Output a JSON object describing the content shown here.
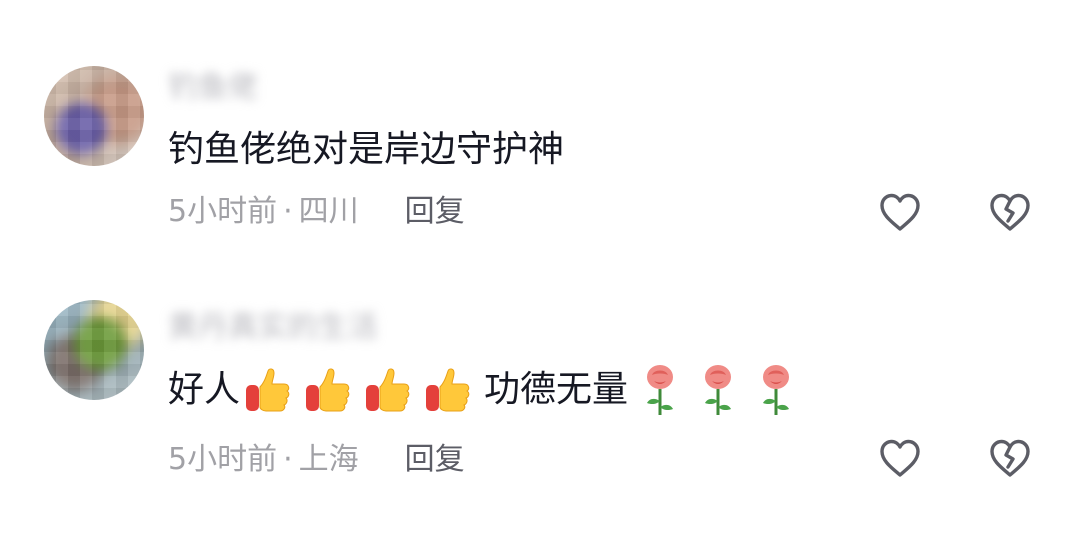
{
  "comments": [
    {
      "username": "钓鱼佬",
      "text": "钓鱼佬绝对是岸边守护神",
      "time": "5小时前",
      "separator": "·",
      "location": "四川",
      "reply_label": "回复",
      "like_icon": "heart-outline-icon",
      "dislike_icon": "broken-heart-icon"
    },
    {
      "username": "黄丹真实的生活",
      "text_parts": [
        "好人",
        "功德无量"
      ],
      "thumbs_emoji": "thumbs-up-emoji",
      "rose_emoji": "rose-emoji",
      "time": "5小时前",
      "separator": "·",
      "location": "上海",
      "reply_label": "回复",
      "like_icon": "heart-outline-icon",
      "dislike_icon": "broken-heart-icon"
    }
  ],
  "colors": {
    "text_primary": "#161823",
    "text_secondary": "#a1a1a6",
    "reply": "#5c5d66",
    "icon_stroke": "#5c5d66"
  }
}
